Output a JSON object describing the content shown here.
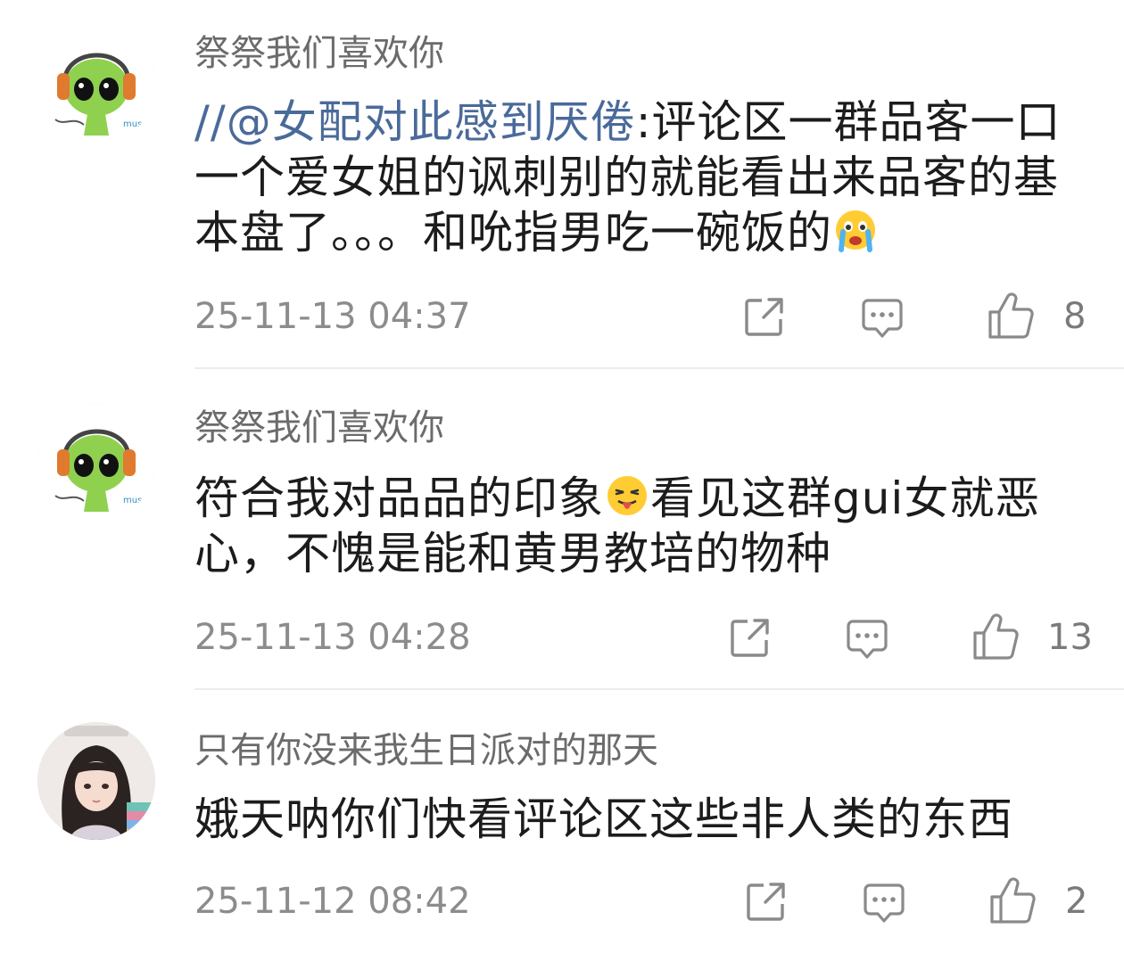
{
  "comments": [
    {
      "username": "祭祭我们喜欢你",
      "avatar_icon": "alien-headphones-avatar",
      "mention": "//@女配对此感到厌倦",
      "content_before_emoji": ":评论区一群品客一口一个爱女姐的讽刺别的就能看出来品客的基本盘了。。。和吮指男吃一碗饭的",
      "emoji_name": "crying-face-emoji",
      "content_after_emoji": "",
      "timestamp": "25-11-13 04:37",
      "share_icon": "share-icon",
      "reply_icon": "comment-icon",
      "like_icon": "thumbs-up-icon",
      "like_count": "8"
    },
    {
      "username": "祭祭我们喜欢你",
      "avatar_icon": "alien-headphones-avatar",
      "content_before_emoji": "符合我对品品的印象",
      "emoji_name": "tongue-out-face-emoji",
      "content_after_emoji": "看见这群gui女就恶心，不愧是能和黄男教培的物种",
      "timestamp": "25-11-13 04:28",
      "share_icon": "share-icon",
      "reply_icon": "comment-icon",
      "like_icon": "thumbs-up-icon",
      "like_count": "13"
    },
    {
      "username": "只有你没来我生日派对的那天",
      "avatar_icon": "girl-photo-avatar",
      "content": "娥天呐你们快看评论区这些非人类的东西",
      "timestamp": "25-11-12 08:42",
      "share_icon": "share-icon",
      "reply_icon": "comment-icon",
      "like_icon": "thumbs-up-icon",
      "like_count": "2"
    }
  ],
  "colors": {
    "username": "#6b6b6b",
    "mention": "#4a6a9a",
    "timestamp": "#8c8c8c",
    "icon": "#8a8a8a",
    "divider": "#ececec"
  }
}
